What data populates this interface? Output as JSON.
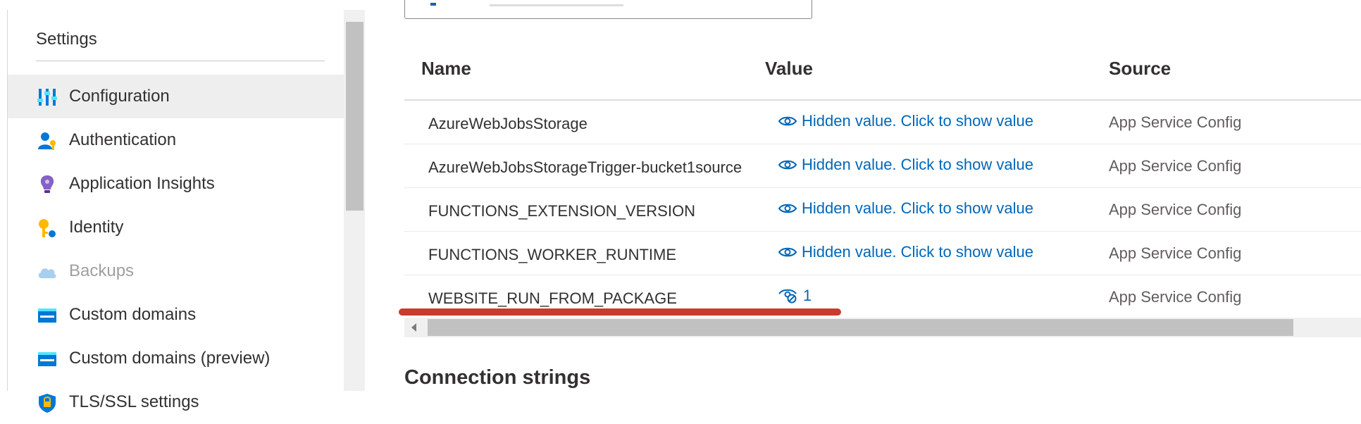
{
  "sidebar": {
    "section_title": "Settings",
    "items": [
      {
        "label": "Configuration",
        "icon": "configuration-icon",
        "active": true
      },
      {
        "label": "Authentication",
        "icon": "authentication-icon"
      },
      {
        "label": "Application Insights",
        "icon": "application-insights-icon"
      },
      {
        "label": "Identity",
        "icon": "identity-icon"
      },
      {
        "label": "Backups",
        "icon": "backups-icon",
        "disabled": true
      },
      {
        "label": "Custom domains",
        "icon": "custom-domains-icon"
      },
      {
        "label": "Custom domains (preview)",
        "icon": "custom-domains-preview-icon"
      },
      {
        "label": "TLS/SSL settings",
        "icon": "tls-ssl-icon"
      }
    ]
  },
  "table": {
    "headers": {
      "name": "Name",
      "value": "Value",
      "source": "Source"
    },
    "rows": [
      {
        "name": "AzureWebJobsStorage",
        "value": "Hidden value. Click to show value",
        "source": "App Service Config"
      },
      {
        "name": "AzureWebJobsStorageTrigger-bucket1source",
        "value": "Hidden value. Click to show value",
        "source": "App Service Config"
      },
      {
        "name": "FUNCTIONS_EXTENSION_VERSION",
        "value": "Hidden value. Click to show value",
        "source": "App Service Config"
      },
      {
        "name": "FUNCTIONS_WORKER_RUNTIME",
        "value": "Hidden value. Click to show value",
        "source": "App Service Config"
      },
      {
        "name": "WEBSITE_RUN_FROM_PACKAGE",
        "value": "1",
        "source": "App Service Config"
      }
    ]
  },
  "sections": {
    "connection_strings": "Connection strings"
  },
  "colors": {
    "link": "#0067b8",
    "annotation": "#c93b2a",
    "active_bg": "#eeeeee"
  }
}
